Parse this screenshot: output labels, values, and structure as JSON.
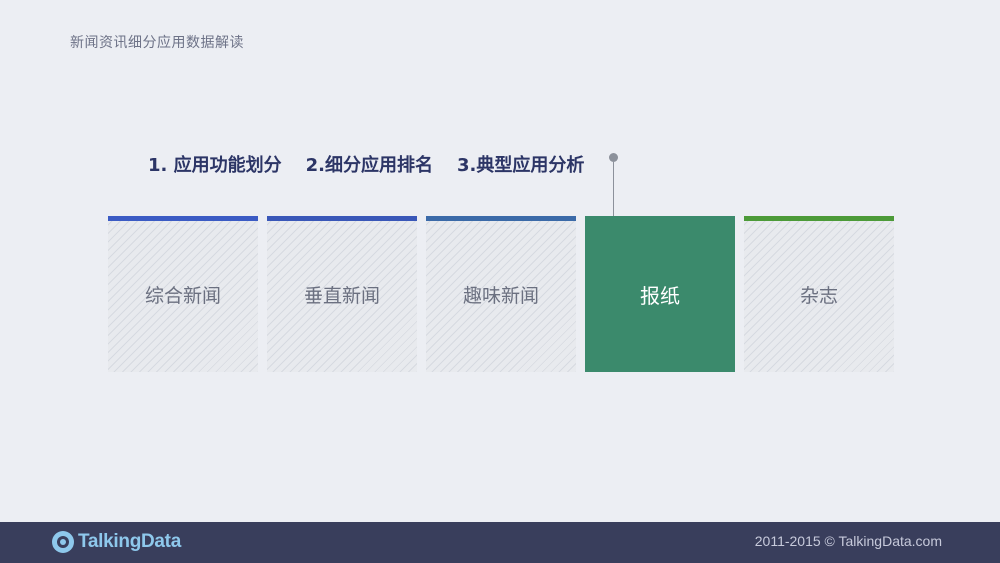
{
  "header": {
    "title": "新闻资讯细分应用数据解读"
  },
  "sections": {
    "items": [
      {
        "label": "1. 应用功能划分"
      },
      {
        "label": "2.细分应用排名"
      },
      {
        "label": "3.典型应用分析"
      }
    ]
  },
  "categories": {
    "items": [
      {
        "label": "综合新闻",
        "accent": "#3b5bc4",
        "active": false
      },
      {
        "label": "垂直新闻",
        "accent": "#3957b8",
        "active": false
      },
      {
        "label": "趣味新闻",
        "accent": "#3b6aa8",
        "active": false
      },
      {
        "label": "报纸",
        "accent": "#3b8a6c",
        "active": true
      },
      {
        "label": "杂志",
        "accent": "#4c9a38",
        "active": false
      }
    ]
  },
  "footer": {
    "logo_text": "TalkingData",
    "copyright": "2011-2015 © TalkingData.com"
  },
  "colors": {
    "background": "#eceef3",
    "footer_bg": "#393e5c",
    "active_card": "#3b8a6c",
    "nav_text": "#2c3566"
  }
}
